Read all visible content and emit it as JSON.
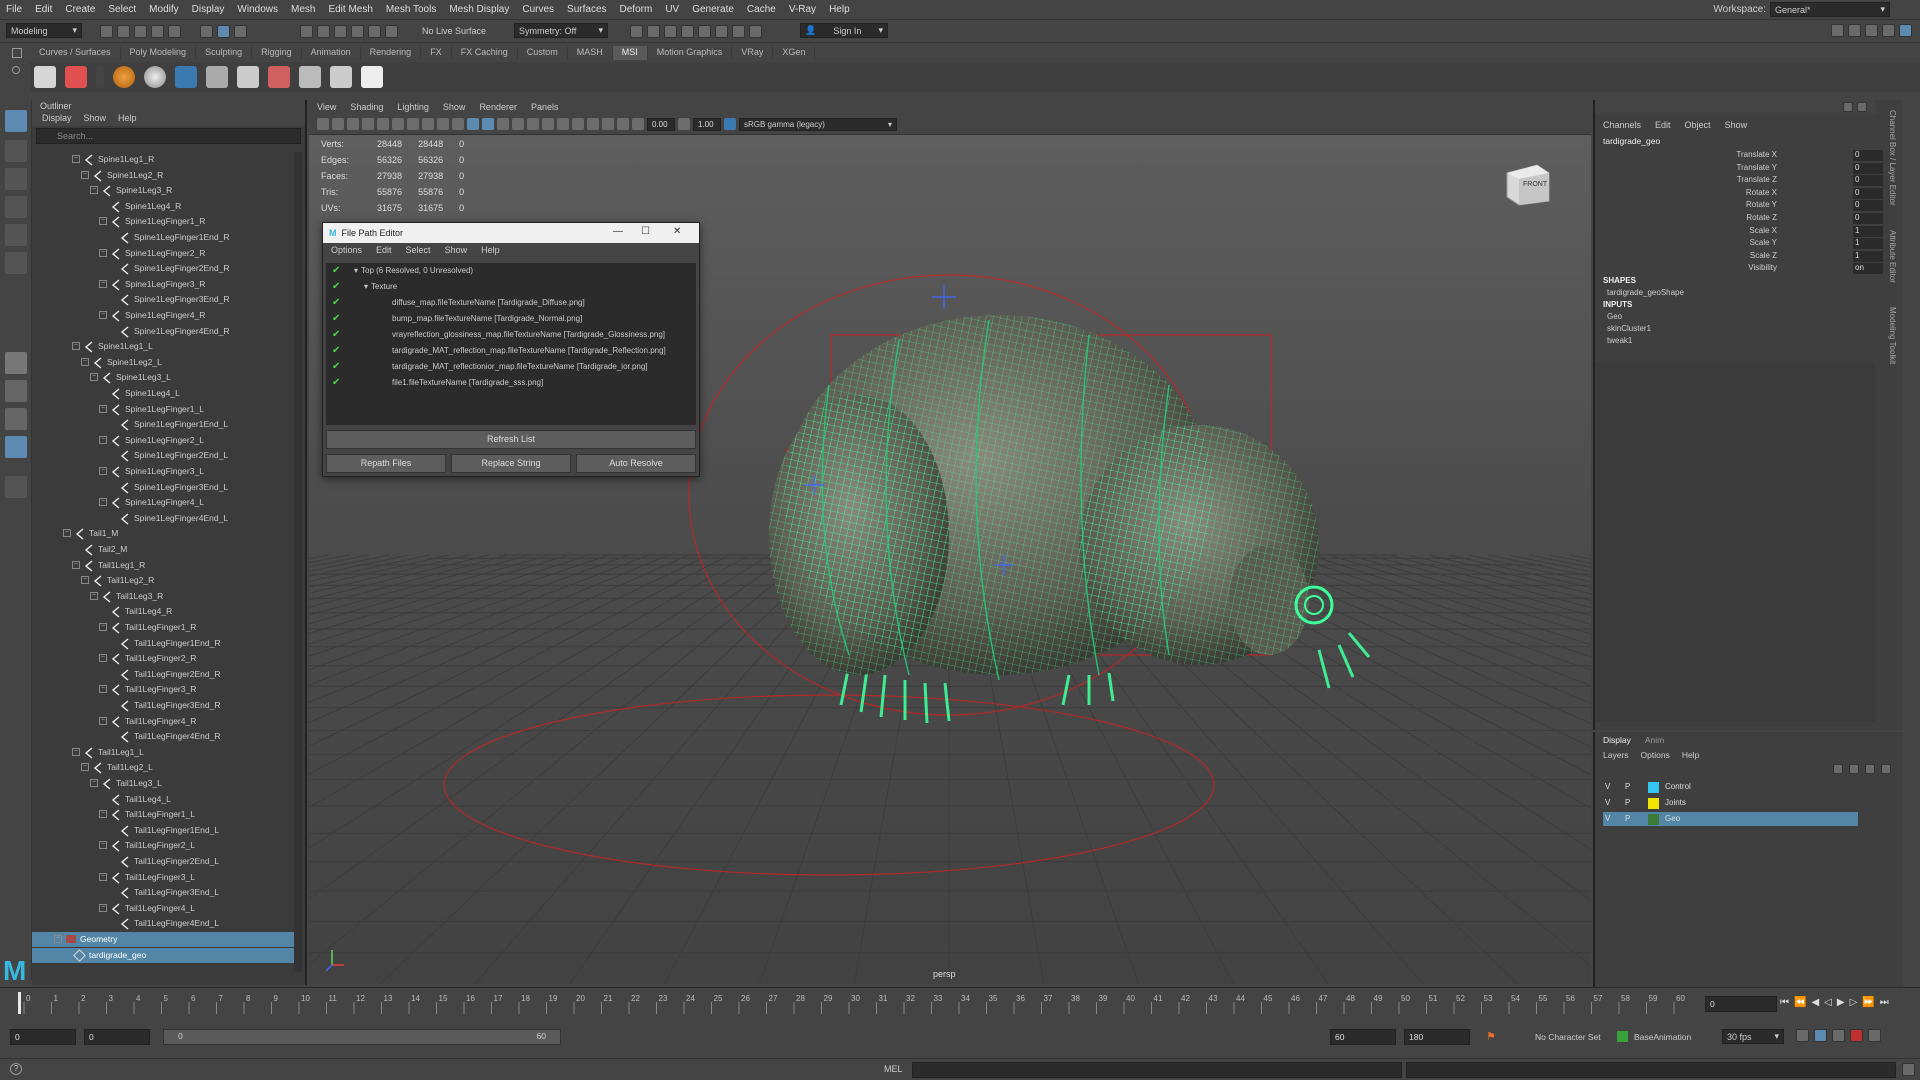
{
  "menubar": {
    "items": [
      "File",
      "Edit",
      "Create",
      "Select",
      "Modify",
      "Display",
      "Windows",
      "Mesh",
      "Edit Mesh",
      "Mesh Tools",
      "Mesh Display",
      "Curves",
      "Surfaces",
      "Deform",
      "UV",
      "Generate",
      "Cache",
      "V-Ray",
      "Help"
    ],
    "workspace_label": "Workspace:",
    "workspace_value": "General*"
  },
  "statusline": {
    "mode": "Modeling",
    "live_surface": "No Live Surface",
    "symmetry": "Symmetry: Off",
    "sign_in": "Sign In"
  },
  "shelf": {
    "tabs": [
      "Curves / Surfaces",
      "Poly Modeling",
      "Sculpting",
      "Rigging",
      "Animation",
      "Rendering",
      "FX",
      "FX Caching",
      "Custom",
      "MASH",
      "MSI",
      "Motion Graphics",
      "VRay",
      "XGen"
    ],
    "active_tab": "MSI"
  },
  "outliner": {
    "title": "Outliner",
    "menu": [
      "Display",
      "Show",
      "Help"
    ],
    "search_placeholder": "Search...",
    "rows": [
      {
        "label": "Spine1Leg1_R",
        "depth": 4,
        "expander": "-"
      },
      {
        "label": "Spine1Leg2_R",
        "depth": 5,
        "expander": "-"
      },
      {
        "label": "Spine1Leg3_R",
        "depth": 6,
        "expander": "-"
      },
      {
        "label": "Spine1Leg4_R",
        "depth": 7,
        "expander": ""
      },
      {
        "label": "Spine1LegFinger1_R",
        "depth": 7,
        "expander": "-"
      },
      {
        "label": "Spine1LegFinger1End_R",
        "depth": 8,
        "expander": ""
      },
      {
        "label": "Spine1LegFinger2_R",
        "depth": 7,
        "expander": "-"
      },
      {
        "label": "Spine1LegFinger2End_R",
        "depth": 8,
        "expander": ""
      },
      {
        "label": "Spine1LegFinger3_R",
        "depth": 7,
        "expander": "-"
      },
      {
        "label": "Spine1LegFinger3End_R",
        "depth": 8,
        "expander": ""
      },
      {
        "label": "Spine1LegFinger4_R",
        "depth": 7,
        "expander": "-"
      },
      {
        "label": "Spine1LegFinger4End_R",
        "depth": 8,
        "expander": ""
      },
      {
        "label": "Spine1Leg1_L",
        "depth": 4,
        "expander": "-"
      },
      {
        "label": "Spine1Leg2_L",
        "depth": 5,
        "expander": "-"
      },
      {
        "label": "Spine1Leg3_L",
        "depth": 6,
        "expander": "-"
      },
      {
        "label": "Spine1Leg4_L",
        "depth": 7,
        "expander": ""
      },
      {
        "label": "Spine1LegFinger1_L",
        "depth": 7,
        "expander": "-"
      },
      {
        "label": "Spine1LegFinger1End_L",
        "depth": 8,
        "expander": ""
      },
      {
        "label": "Spine1LegFinger2_L",
        "depth": 7,
        "expander": "-"
      },
      {
        "label": "Spine1LegFinger2End_L",
        "depth": 8,
        "expander": ""
      },
      {
        "label": "Spine1LegFinger3_L",
        "depth": 7,
        "expander": "-"
      },
      {
        "label": "Spine1LegFinger3End_L",
        "depth": 8,
        "expander": ""
      },
      {
        "label": "Spine1LegFinger4_L",
        "depth": 7,
        "expander": "-"
      },
      {
        "label": "Spine1LegFinger4End_L",
        "depth": 8,
        "expander": ""
      },
      {
        "label": "Tail1_M",
        "depth": 3,
        "expander": "-"
      },
      {
        "label": "Tail2_M",
        "depth": 4,
        "expander": ""
      },
      {
        "label": "Tail1Leg1_R",
        "depth": 4,
        "expander": "-"
      },
      {
        "label": "Tail1Leg2_R",
        "depth": 5,
        "expander": "-"
      },
      {
        "label": "Tail1Leg3_R",
        "depth": 6,
        "expander": "-"
      },
      {
        "label": "Tail1Leg4_R",
        "depth": 7,
        "expander": ""
      },
      {
        "label": "Tail1LegFinger1_R",
        "depth": 7,
        "expander": "-"
      },
      {
        "label": "Tail1LegFinger1End_R",
        "depth": 8,
        "expander": ""
      },
      {
        "label": "Tail1LegFinger2_R",
        "depth": 7,
        "expander": "-"
      },
      {
        "label": "Tail1LegFinger2End_R",
        "depth": 8,
        "expander": ""
      },
      {
        "label": "Tail1LegFinger3_R",
        "depth": 7,
        "expander": "-"
      },
      {
        "label": "Tail1LegFinger3End_R",
        "depth": 8,
        "expander": ""
      },
      {
        "label": "Tail1LegFinger4_R",
        "depth": 7,
        "expander": "-"
      },
      {
        "label": "Tail1LegFinger4End_R",
        "depth": 8,
        "expander": ""
      },
      {
        "label": "Tail1Leg1_L",
        "depth": 4,
        "expander": "-"
      },
      {
        "label": "Tail1Leg2_L",
        "depth": 5,
        "expander": "-"
      },
      {
        "label": "Tail1Leg3_L",
        "depth": 6,
        "expander": "-"
      },
      {
        "label": "Tail1Leg4_L",
        "depth": 7,
        "expander": ""
      },
      {
        "label": "Tail1LegFinger1_L",
        "depth": 7,
        "expander": "-"
      },
      {
        "label": "Tail1LegFinger1End_L",
        "depth": 8,
        "expander": ""
      },
      {
        "label": "Tail1LegFinger2_L",
        "depth": 7,
        "expander": "-"
      },
      {
        "label": "Tail1LegFinger2End_L",
        "depth": 8,
        "expander": ""
      },
      {
        "label": "Tail1LegFinger3_L",
        "depth": 7,
        "expander": "-"
      },
      {
        "label": "Tail1LegFinger3End_L",
        "depth": 8,
        "expander": ""
      },
      {
        "label": "Tail1LegFinger4_L",
        "depth": 7,
        "expander": "-"
      },
      {
        "label": "Tail1LegFinger4End_L",
        "depth": 8,
        "expander": ""
      },
      {
        "label": "Geometry",
        "depth": 2,
        "expander": "-",
        "kind": "group",
        "selected": true
      },
      {
        "label": "tardigrade_geo",
        "depth": 3,
        "expander": "",
        "kind": "mesh",
        "selected": true
      }
    ]
  },
  "viewport": {
    "menu": [
      "View",
      "Shading",
      "Lighting",
      "Show",
      "Renderer",
      "Panels"
    ],
    "exposure": "0.00",
    "gamma": "1.00",
    "color_space": "sRGB gamma (legacy)",
    "hud": [
      {
        "label": "Verts:",
        "a": "28448",
        "b": "28448",
        "c": "0"
      },
      {
        "label": "Edges:",
        "a": "56326",
        "b": "56326",
        "c": "0"
      },
      {
        "label": "Faces:",
        "a": "27938",
        "b": "27938",
        "c": "0"
      },
      {
        "label": "Tris:",
        "a": "55876",
        "b": "55876",
        "c": "0"
      },
      {
        "label": "UVs:",
        "a": "31675",
        "b": "31675",
        "c": "0"
      }
    ],
    "view_cube_label": "FRONT",
    "camera": "persp",
    "wire_color": "#3dff9a"
  },
  "file_path_editor": {
    "title": "File Path Editor",
    "menu": [
      "Options",
      "Edit",
      "Select",
      "Show",
      "Help"
    ],
    "rows": [
      {
        "label": "Top (6 Resolved, 0 Unresolved)",
        "indent": 0,
        "arrow": "▾"
      },
      {
        "label": "Texture",
        "indent": 1,
        "arrow": "▾"
      },
      {
        "label": "diffuse_map.fileTextureName [Tardigrade_Diffuse.png]",
        "indent": 2,
        "arrow": ""
      },
      {
        "label": "bump_map.fileTextureName [Tardigrade_Normal.png]",
        "indent": 2,
        "arrow": ""
      },
      {
        "label": "vrayreflection_glossiness_map.fileTextureName [Tardigrade_Glossiness.png]",
        "indent": 2,
        "arrow": ""
      },
      {
        "label": "tardigrade_MAT_reflection_map.fileTextureName [Tardigrade_Reflection.png]",
        "indent": 2,
        "arrow": ""
      },
      {
        "label": "tardigrade_MAT_reflectionior_map.fileTextureName [Tardigrade_ior.png]",
        "indent": 2,
        "arrow": ""
      },
      {
        "label": "file1.fileTextureName [Tardigrade_sss.png]",
        "indent": 2,
        "arrow": ""
      }
    ],
    "refresh": "Refresh List",
    "repath": "Repath Files",
    "replace": "Replace String",
    "auto": "Auto Resolve"
  },
  "channel_box": {
    "menu": [
      "Channels",
      "Edit",
      "Object",
      "Show"
    ],
    "object": "tardigrade_geo",
    "attrs": [
      {
        "label": "Translate X",
        "value": "0"
      },
      {
        "label": "Translate Y",
        "value": "0"
      },
      {
        "label": "Translate Z",
        "value": "0"
      },
      {
        "label": "Rotate X",
        "value": "0"
      },
      {
        "label": "Rotate Y",
        "value": "0"
      },
      {
        "label": "Rotate Z",
        "value": "0"
      },
      {
        "label": "Scale X",
        "value": "1"
      },
      {
        "label": "Scale Y",
        "value": "1"
      },
      {
        "label": "Scale Z",
        "value": "1"
      },
      {
        "label": "Visibility",
        "value": "on"
      }
    ],
    "shapes_header": "SHAPES",
    "shape": "tardigrade_geoShape",
    "inputs_header": "INPUTS",
    "inputs": [
      "Geo",
      "skinCluster1",
      "tweak1"
    ],
    "side_tabs": [
      "Channel Box / Layer Editor",
      "Attribute Editor",
      "Modeling Toolkit"
    ]
  },
  "layer_editor": {
    "tabs": [
      "Display",
      "Anim"
    ],
    "menu": [
      "Layers",
      "Options",
      "Help"
    ],
    "layers": [
      {
        "v": "V",
        "p": "P",
        "name": "Control",
        "color": "#33c6f0",
        "selected": false
      },
      {
        "v": "V",
        "p": "P",
        "name": "Joints",
        "color": "#f2e500",
        "selected": false
      },
      {
        "v": "V",
        "p": "P",
        "name": "Geo",
        "color": "#3a7a3a",
        "selected": true
      }
    ]
  },
  "timeline": {
    "ticks": [
      "0",
      "1",
      "2",
      "3",
      "4",
      "5",
      "6",
      "7",
      "8",
      "9",
      "10",
      "11",
      "12",
      "13",
      "14",
      "15",
      "16",
      "17",
      "18",
      "19",
      "20",
      "21",
      "22",
      "23",
      "24",
      "25",
      "26",
      "27",
      "28",
      "29",
      "30",
      "31",
      "32",
      "33",
      "34",
      "35",
      "36",
      "37",
      "38",
      "39",
      "40",
      "41",
      "42",
      "43",
      "44",
      "45",
      "46",
      "47",
      "48",
      "49",
      "50",
      "51",
      "52",
      "53",
      "54",
      "55",
      "56",
      "57",
      "58",
      "59",
      "60"
    ],
    "current_frame": "0"
  },
  "range": {
    "start": "0",
    "anim_start": "0",
    "slider_start": "0",
    "slider_end": "60",
    "play_end": "60",
    "anim_end": "180",
    "character_set": "No Character Set",
    "anim_layer": "BaseAnimation",
    "fps": "30 fps"
  },
  "command_line": {
    "lang": "MEL"
  }
}
